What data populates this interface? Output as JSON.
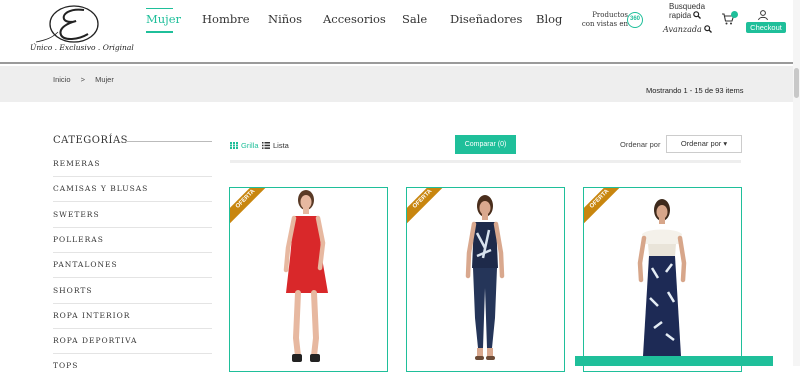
{
  "brand": {
    "tagline": "Único . Exclusivo . Original"
  },
  "nav": {
    "items": [
      {
        "label": "Mujer",
        "active": true
      },
      {
        "label": "Hombre"
      },
      {
        "label": "Niños"
      },
      {
        "label": "Accesorios"
      },
      {
        "label": "Sale"
      },
      {
        "label": "Diseñadores"
      },
      {
        "label": "Blog"
      }
    ],
    "products360_label": "Productos con vistas en",
    "products360_badge": "360",
    "quick_search_line1": "Busqueda",
    "quick_search_line2": "rapida",
    "advanced_search": "Avanzada",
    "checkout_label": "Checkout"
  },
  "breadcrumb": {
    "home": "Inicio",
    "separator": ">",
    "current": "Mujer"
  },
  "results_count": "Mostrando 1 - 15 de 93 items",
  "sidebar": {
    "title": "CATEGORÍAS",
    "items": [
      "REMERAS",
      "CAMISAS Y BLUSAS",
      "SWETERS",
      "POLLERAS",
      "PANTALONES",
      "SHORTS",
      "ROPA INTERIOR",
      "ROPA DEPORTIVA",
      "TOPS"
    ]
  },
  "toolbar": {
    "grid_label": "Grilla",
    "list_label": "Lista",
    "compare_label": "Comparar (0)",
    "sort_label": "Ordenar por",
    "sort_value": "Ordenar por ▾"
  },
  "products": [
    {
      "badge": "OFERTA",
      "dress_color": "#d9282a"
    },
    {
      "badge": "OFERTA",
      "dress_color": "#1e2a4a"
    },
    {
      "badge": "OFERTA",
      "dress_color": "#1d2a55"
    }
  ],
  "colors": {
    "accent": "#1fbf9a",
    "ribbon": "#c8860f"
  }
}
